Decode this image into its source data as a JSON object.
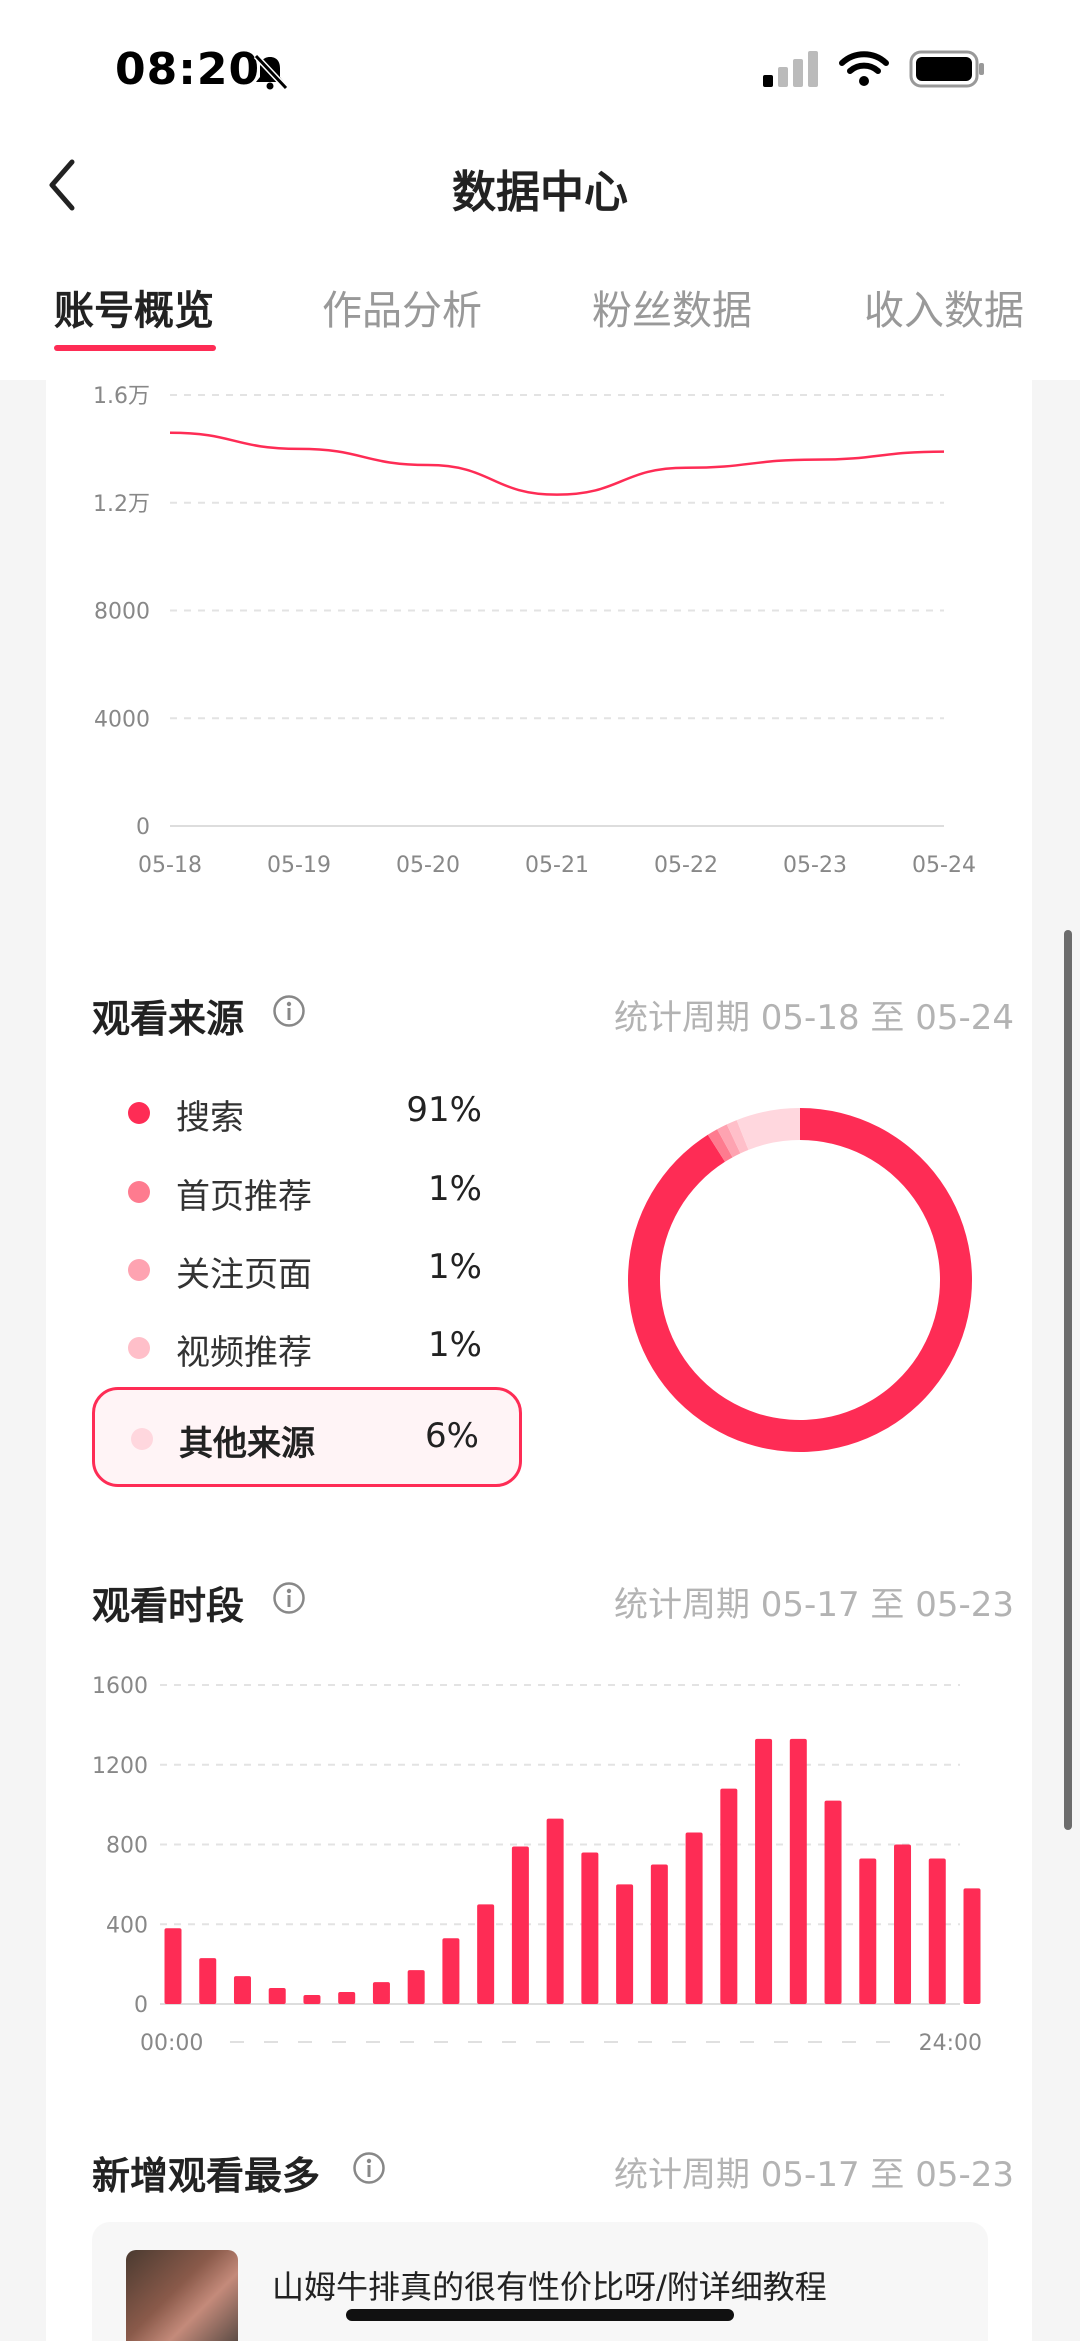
{
  "status_bar": {
    "time": "08:20"
  },
  "nav": {
    "title": "数据中心"
  },
  "tabs": [
    {
      "label": "账号概览",
      "active": true
    },
    {
      "label": "作品分析",
      "active": false
    },
    {
      "label": "粉丝数据",
      "active": false
    },
    {
      "label": "收入数据",
      "active": false
    }
  ],
  "view_source": {
    "title": "观看来源",
    "period": "统计周期 05-18 至 05-24",
    "items": [
      {
        "label": "搜索",
        "value": "91%",
        "color": "#fe2c55"
      },
      {
        "label": "首页推荐",
        "value": "1%",
        "color": "#fe7b8f"
      },
      {
        "label": "关注页面",
        "value": "1%",
        "color": "#fea3b1"
      },
      {
        "label": "视频推荐",
        "value": "1%",
        "color": "#ffbfc9"
      },
      {
        "label": "其他来源",
        "value": "6%",
        "color": "#ffd7de"
      }
    ]
  },
  "view_time": {
    "title": "观看时段",
    "period": "统计周期 05-17 至 05-23"
  },
  "top_new": {
    "title": "新增观看最多",
    "period": "统计周期 05-17 至 05-23",
    "video_title": "山姆牛排真的很有性价比呀/附详细教程"
  },
  "colors": {
    "accent": "#fe2c55"
  },
  "chart_data": [
    {
      "type": "line",
      "x": [
        "05-18",
        "05-19",
        "05-20",
        "05-21",
        "05-22",
        "05-23",
        "05-24"
      ],
      "series": [
        {
          "values": [
            14600,
            14000,
            13400,
            12300,
            13300,
            13600,
            13900
          ]
        }
      ],
      "ytick_labels": [
        "0",
        "4000",
        "8000",
        "1.2万",
        "1.6万"
      ],
      "ylim": [
        0,
        16000
      ],
      "grid": true
    },
    {
      "type": "pie",
      "labels": [
        "搜索",
        "首页推荐",
        "关注页面",
        "视频推荐",
        "其他来源"
      ],
      "values": [
        91,
        1,
        1,
        1,
        6
      ]
    },
    {
      "type": "bar",
      "x_start_label": "00:00",
      "x_end_label": "24:00",
      "values": [
        380,
        230,
        140,
        80,
        45,
        60,
        110,
        170,
        330,
        500,
        790,
        930,
        760,
        600,
        700,
        860,
        1080,
        1330,
        1330,
        1020,
        730,
        800,
        730,
        580
      ],
      "ytick_labels": [
        "0",
        "400",
        "800",
        "1200",
        "1600"
      ],
      "ylim": [
        0,
        1600
      ],
      "grid": true
    }
  ]
}
